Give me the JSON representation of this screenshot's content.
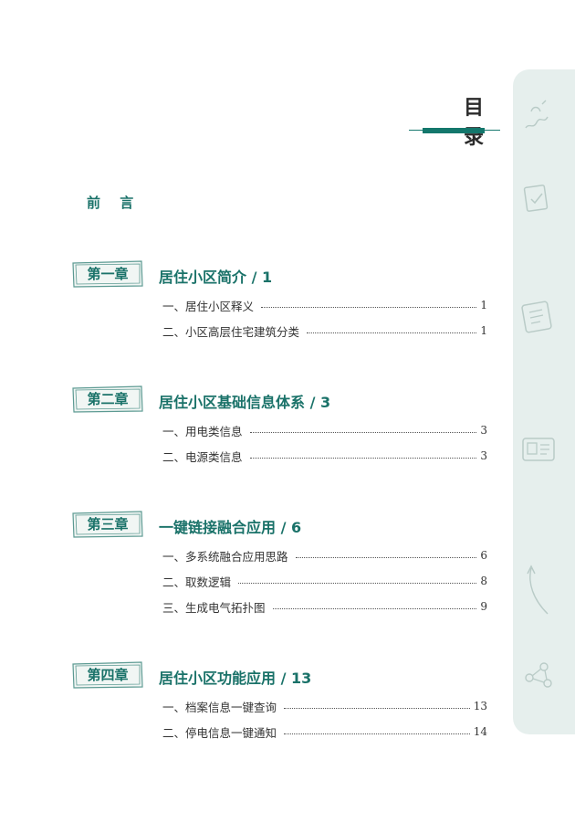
{
  "toc_title": "目 录",
  "preface": "前 言",
  "chapters": [
    {
      "badge": "第一章",
      "title": "居住小区简介 / 1",
      "entries": [
        {
          "label": "一、居住小区释义",
          "page": "1"
        },
        {
          "label": "二、小区高层住宅建筑分类",
          "page": "1"
        }
      ]
    },
    {
      "badge": "第二章",
      "title": "居住小区基础信息体系 / 3",
      "entries": [
        {
          "label": "一、用电类信息",
          "page": "3"
        },
        {
          "label": "二、电源类信息",
          "page": "3"
        }
      ]
    },
    {
      "badge": "第三章",
      "title": "一键链接融合应用 / 6",
      "entries": [
        {
          "label": "一、多系统融合应用思路",
          "page": "6"
        },
        {
          "label": "二、取数逻辑",
          "page": "8"
        },
        {
          "label": "三、生成电气拓扑图",
          "page": "9"
        }
      ]
    },
    {
      "badge": "第四章",
      "title": "居住小区功能应用 / 13",
      "entries": [
        {
          "label": "一、档案信息一键查询",
          "page": "13"
        },
        {
          "label": "二、停电信息一键通知",
          "page": "14"
        }
      ]
    }
  ],
  "side_icons": [
    "scribble-icon",
    "document-check-icon",
    "notepad-icon",
    "id-card-icon",
    "arrow-curve-icon",
    "network-icon"
  ]
}
